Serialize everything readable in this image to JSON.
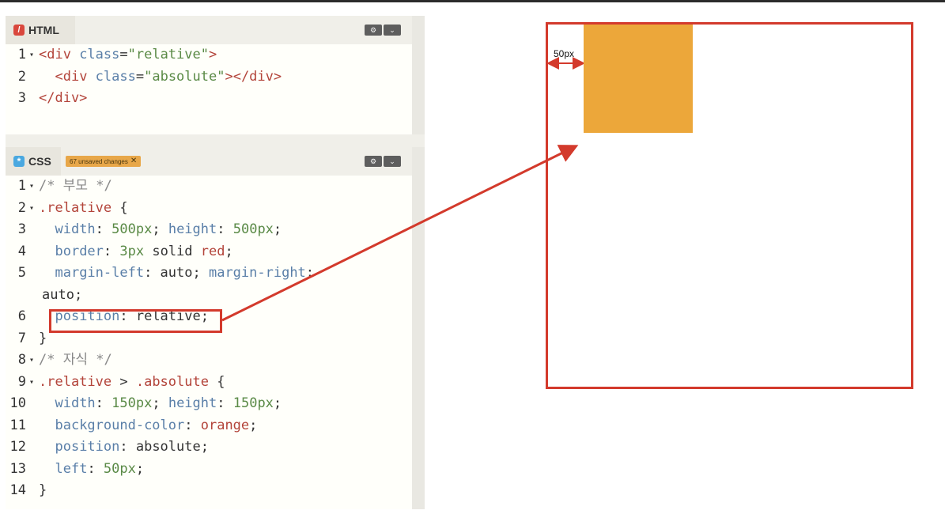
{
  "html_panel": {
    "tab_label": "HTML",
    "lines": [
      {
        "n": "1",
        "fold": "▾",
        "parts": [
          [
            "tag",
            "<div "
          ],
          [
            "attr",
            "class"
          ],
          [
            "kwplain",
            "="
          ],
          [
            "str",
            "\"relative\""
          ],
          [
            "tag",
            ">"
          ]
        ]
      },
      {
        "n": "2",
        "fold": "",
        "parts": [
          [
            "kwplain",
            "  "
          ],
          [
            "tag",
            "<div "
          ],
          [
            "attr",
            "class"
          ],
          [
            "kwplain",
            "="
          ],
          [
            "str",
            "\"absolute\""
          ],
          [
            "tag",
            "></div>"
          ]
        ]
      },
      {
        "n": "3",
        "fold": "",
        "parts": [
          [
            "tag",
            "</div>"
          ]
        ]
      }
    ]
  },
  "css_panel": {
    "tab_label": "CSS",
    "badge": "67 unsaved changes",
    "lines": [
      {
        "n": "1",
        "fold": "▾",
        "parts": [
          [
            "cmt",
            "/* 부모 */"
          ]
        ]
      },
      {
        "n": "2",
        "fold": "▾",
        "parts": [
          [
            "sel",
            ".relative"
          ],
          [
            "kwplain",
            " {"
          ]
        ]
      },
      {
        "n": "3",
        "fold": "",
        "parts": [
          [
            "kwplain",
            "  "
          ],
          [
            "prop",
            "width"
          ],
          [
            "kwplain",
            ": "
          ],
          [
            "num",
            "500px"
          ],
          [
            "kwplain",
            "; "
          ],
          [
            "prop",
            "height"
          ],
          [
            "kwplain",
            ": "
          ],
          [
            "num",
            "500px"
          ],
          [
            "kwplain",
            ";"
          ]
        ]
      },
      {
        "n": "4",
        "fold": "",
        "parts": [
          [
            "kwplain",
            "  "
          ],
          [
            "prop",
            "border"
          ],
          [
            "kwplain",
            ": "
          ],
          [
            "num",
            "3px"
          ],
          [
            "kwplain",
            " solid "
          ],
          [
            "kwred",
            "red"
          ],
          [
            "kwplain",
            ";"
          ]
        ]
      },
      {
        "n": "5",
        "fold": "",
        "parts": [
          [
            "kwplain",
            "  "
          ],
          [
            "prop",
            "margin-left"
          ],
          [
            "kwplain",
            ": auto; "
          ],
          [
            "prop",
            "margin-right"
          ],
          [
            "kwplain",
            ":"
          ]
        ]
      },
      {
        "n": "",
        "fold": "",
        "parts": [
          [
            "kwplain",
            "auto;"
          ]
        ]
      },
      {
        "n": "6",
        "fold": "",
        "parts": [
          [
            "kwplain",
            "  "
          ],
          [
            "prop",
            "position"
          ],
          [
            "kwplain",
            ": relative;"
          ]
        ]
      },
      {
        "n": "7",
        "fold": "",
        "parts": [
          [
            "kwplain",
            "}"
          ]
        ]
      },
      {
        "n": "8",
        "fold": "▾",
        "parts": [
          [
            "cmt",
            "/* 자식 */"
          ]
        ]
      },
      {
        "n": "9",
        "fold": "▾",
        "parts": [
          [
            "sel",
            ".relative"
          ],
          [
            "kwplain",
            " > "
          ],
          [
            "sel",
            ".absolute"
          ],
          [
            "kwplain",
            " {"
          ]
        ]
      },
      {
        "n": "10",
        "fold": "",
        "parts": [
          [
            "kwplain",
            "  "
          ],
          [
            "prop",
            "width"
          ],
          [
            "kwplain",
            ": "
          ],
          [
            "num",
            "150px"
          ],
          [
            "kwplain",
            "; "
          ],
          [
            "prop",
            "height"
          ],
          [
            "kwplain",
            ": "
          ],
          [
            "num",
            "150px"
          ],
          [
            "kwplain",
            ";"
          ]
        ]
      },
      {
        "n": "11",
        "fold": "",
        "parts": [
          [
            "kwplain",
            "  "
          ],
          [
            "prop",
            "background-color"
          ],
          [
            "kwplain",
            ": "
          ],
          [
            "kwred",
            "orange"
          ],
          [
            "kwplain",
            ";"
          ]
        ]
      },
      {
        "n": "12",
        "fold": "",
        "parts": [
          [
            "kwplain",
            "  "
          ],
          [
            "prop",
            "position"
          ],
          [
            "kwplain",
            ": absolute;"
          ]
        ]
      },
      {
        "n": "13",
        "fold": "",
        "parts": [
          [
            "kwplain",
            "  "
          ],
          [
            "prop",
            "left"
          ],
          [
            "kwplain",
            ": "
          ],
          [
            "num",
            "50px"
          ],
          [
            "kwplain",
            ";"
          ]
        ]
      },
      {
        "n": "14",
        "fold": "",
        "parts": [
          [
            "kwplain",
            "}"
          ]
        ]
      }
    ]
  },
  "demo": {
    "offset_label": "50px",
    "outer_color": "#d33a2c",
    "inner_color": "#eca73a"
  },
  "icons": {
    "html_tab": "html-icon",
    "css_tab": "css-icon",
    "settings": "gear-icon",
    "expand": "chevron-down-icon"
  }
}
